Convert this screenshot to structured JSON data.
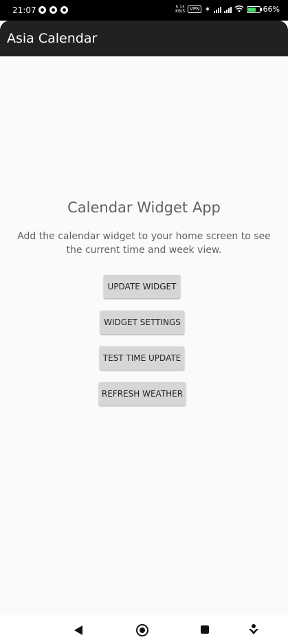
{
  "status_bar": {
    "time": "21:07",
    "network_speed": "5.13 KB/S",
    "vpn": "VPN",
    "battery": "66%",
    "battery_level": 0.66
  },
  "app_bar": {
    "title": "Asia Calendar"
  },
  "main": {
    "heading": "Calendar Widget App",
    "description": "Add the calendar widget to your home screen to see the current time and week view.",
    "buttons": {
      "update_widget": "UPDATE WIDGET",
      "widget_settings": "WIDGET SETTINGS",
      "test_time_update": "TEST TIME UPDATE",
      "refresh_weather": "REFRESH WEATHER"
    }
  },
  "colors": {
    "app_bar_bg": "#212121",
    "background": "#fafafa",
    "button_bg": "#d6d6d6",
    "text_muted": "#616161"
  },
  "icons": [
    "back-icon",
    "home-icon",
    "recents-icon",
    "assistant-icon",
    "wifi-icon",
    "bluetooth-icon",
    "signal-icon",
    "battery-icon"
  ]
}
